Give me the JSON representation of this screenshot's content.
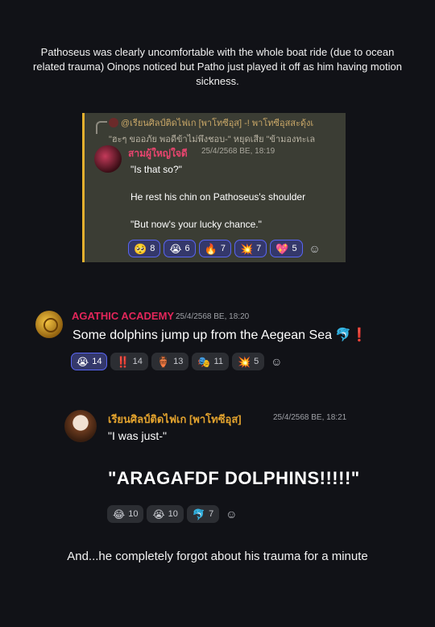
{
  "captions": {
    "top": "Pathoseus was clearly uncomfortable with the whole boat ride (due to ocean related trauma) Oinops noticed but Patho just played it off as him having motion sickness.",
    "bottom": "And...he completely forgot about his trauma for a minute"
  },
  "embedded_card": {
    "reply": {
      "author": "@เรียนศิลป์ติดไฟเก [พาโทซีอุส]",
      "preview_line1": "-! พาโทซีอุสสะดุ้งเ",
      "preview_line2": "\"ฮะๆ ขออภัย พอดีข้าไม่พึงชอบ-\" หยุดเสีย \"ข้ามองทะเล"
    },
    "author": "สามผู้ใหญ่ใจดี",
    "timestamp": "25/4/2568 BE, 18:19",
    "lines": [
      "\"Is that so?\"",
      "He rest his chin on Pathoseus's shoulder",
      "\"But now's your lucky chance.\""
    ],
    "reactions": [
      {
        "emoji": "🥺",
        "count": "8",
        "active": true
      },
      {
        "emoji": "😭",
        "count": "6",
        "active": true
      },
      {
        "emoji": "🔥",
        "count": "7",
        "active": true
      },
      {
        "emoji": "💥",
        "count": "7",
        "active": true
      },
      {
        "emoji": "💖",
        "count": "5",
        "active": true
      }
    ]
  },
  "message1": {
    "author": "AGATHIC ACADEMY",
    "author_color": "#e3265a",
    "timestamp": "25/4/2568 BE, 18:20",
    "text": "Some dolphins jump up from the Aegean Sea 🐬❗",
    "reactions": [
      {
        "emoji": "😭",
        "count": "14",
        "active": true
      },
      {
        "emoji": "‼️",
        "count": "14",
        "active": false
      },
      {
        "emoji": "🏺",
        "count": "13",
        "active": false
      },
      {
        "emoji": "🎭",
        "count": "11",
        "active": false
      },
      {
        "emoji": "💥",
        "count": "5",
        "active": false
      }
    ]
  },
  "message2": {
    "author": "เรียนศิลป์ติดไฟเก [พาโทซีอุส]",
    "author_color": "#e3a32e",
    "timestamp": "25/4/2568 BE, 18:21",
    "text": "\"I was just-\"",
    "shout": "\"ARAGAFDF DOLPHINS!!!!!\"",
    "reactions": [
      {
        "emoji": "😂",
        "count": "10",
        "active": false
      },
      {
        "emoji": "😭",
        "count": "10",
        "active": false
      },
      {
        "emoji": "🐬",
        "count": "7",
        "active": false
      }
    ]
  },
  "add_reaction_icon": "smiley-add-reaction-icon"
}
